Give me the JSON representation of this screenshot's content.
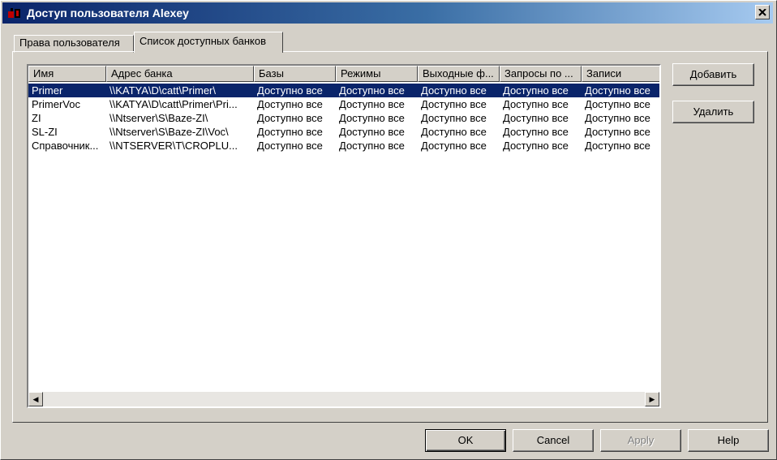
{
  "window": {
    "title": "Доступ пользователя Alexey"
  },
  "tabs": [
    {
      "label": "Права пользователя",
      "active": false
    },
    {
      "label": "Список доступных банков",
      "active": true
    }
  ],
  "list": {
    "columns": [
      "Имя",
      "Адрес банка",
      "Базы",
      "Режимы",
      "Выходные ф...",
      "Запросы по ...",
      "Записи"
    ],
    "rows": [
      {
        "selected": true,
        "cells": [
          "Primer",
          "\\\\KATYA\\D\\catt\\Primer\\",
          "Доступно все",
          "Доступно все",
          "Доступно все",
          "Доступно все",
          "Доступно все"
        ]
      },
      {
        "selected": false,
        "cells": [
          "PrimerVoc",
          "\\\\KATYA\\D\\catt\\Primer\\Pri...",
          "Доступно все",
          "Доступно все",
          "Доступно все",
          "Доступно все",
          "Доступно все"
        ]
      },
      {
        "selected": false,
        "cells": [
          "ZI",
          "\\\\Ntserver\\S\\Baze-ZI\\",
          "Доступно все",
          "Доступно все",
          "Доступно все",
          "Доступно все",
          "Доступно все"
        ]
      },
      {
        "selected": false,
        "cells": [
          "SL-ZI",
          "\\\\Ntserver\\S\\Baze-ZI\\Voc\\",
          "Доступно все",
          "Доступно все",
          "Доступно все",
          "Доступно все",
          "Доступно все"
        ]
      },
      {
        "selected": false,
        "cells": [
          "Справочник...",
          "\\\\NTSERVER\\T\\CROPLU...",
          "Доступно все",
          "Доступно все",
          "Доступно все",
          "Доступно все",
          "Доступно все"
        ]
      }
    ]
  },
  "side_buttons": {
    "add": "Добавить",
    "delete": "Удалить"
  },
  "footer_buttons": {
    "ok": "OK",
    "cancel": "Cancel",
    "apply": "Apply",
    "help": "Help"
  },
  "colors": {
    "selection": "#0a246a",
    "face": "#d4d0c8"
  }
}
